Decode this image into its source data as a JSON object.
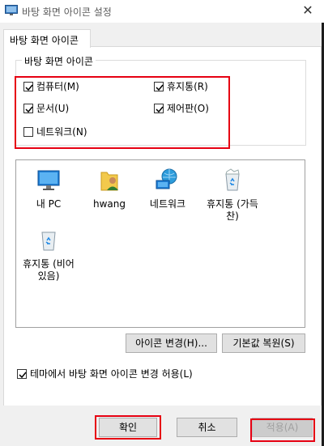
{
  "window": {
    "title": "바탕 화면 아이콘 설정",
    "close_glyph": "✕"
  },
  "tab": {
    "label": "바탕 화면 아이콘"
  },
  "group": {
    "label": "바탕 화면 아이콘"
  },
  "checkboxes": [
    {
      "label": "컴퓨터(M)",
      "checked": true
    },
    {
      "label": "휴지통(R)",
      "checked": true
    },
    {
      "label": "문서(U)",
      "checked": true
    },
    {
      "label": "제어판(O)",
      "checked": true
    },
    {
      "label": "네트워크(N)",
      "checked": false
    }
  ],
  "icons": [
    {
      "caption": "내 PC",
      "icon": "monitor-icon"
    },
    {
      "caption": "hwang",
      "icon": "user-folder-icon"
    },
    {
      "caption": "네트워크",
      "icon": "network-globe-icon"
    },
    {
      "caption": "휴지통 (가득\n찬)",
      "icon": "recycle-bin-full-icon"
    },
    {
      "caption": "휴지통 (비어\n있음)",
      "icon": "recycle-bin-empty-icon"
    }
  ],
  "buttons": {
    "change_icon": "아이콘 변경(H)...",
    "restore_default": "기본값 복원(S)",
    "ok": "확인",
    "cancel": "취소",
    "apply": "적용(A)"
  },
  "theme_checkbox": {
    "label": "테마에서 바탕 화면 아이콘 변경 허용(L)",
    "checked": true
  },
  "colors": {
    "highlight": "#e60012",
    "window_bg": "#f0f0f0",
    "panel_bg": "#ffffff"
  }
}
